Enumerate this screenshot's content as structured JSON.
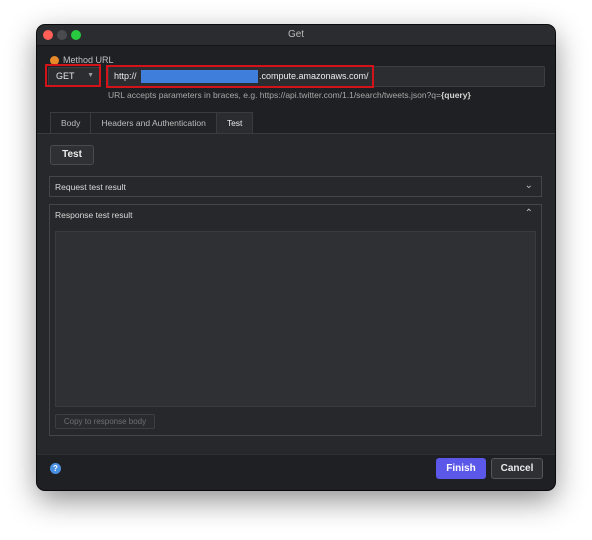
{
  "window": {
    "title": "Get"
  },
  "method": {
    "label": "Method URL",
    "value": "GET",
    "dropdown_icon": "chevron-down-icon",
    "status_color": "#e88a2a"
  },
  "url": {
    "prefix": "http://",
    "suffix": ".compute.amazonaws.com/",
    "hint_text": "URL accepts parameters in braces, e.g. https://api.twitter.com/1.1/search/tweets.json?q=",
    "hint_param": "{query}"
  },
  "tabs": [
    {
      "label": "Body"
    },
    {
      "label": "Headers and Authentication"
    },
    {
      "label": "Test",
      "active": true
    }
  ],
  "test": {
    "button_label": "Test"
  },
  "request_panel": {
    "title": "Request test result",
    "icon": "chevron-down-icon"
  },
  "response_panel": {
    "title": "Response test result",
    "icon": "chevron-up-icon",
    "copy_label": "Copy to response body"
  },
  "footer": {
    "help_symbol": "?",
    "finish_label": "Finish",
    "cancel_label": "Cancel"
  },
  "colors": {
    "accent": "#5b57e8",
    "highlight_border": "#d3121a",
    "redaction": "#3f7edb"
  }
}
